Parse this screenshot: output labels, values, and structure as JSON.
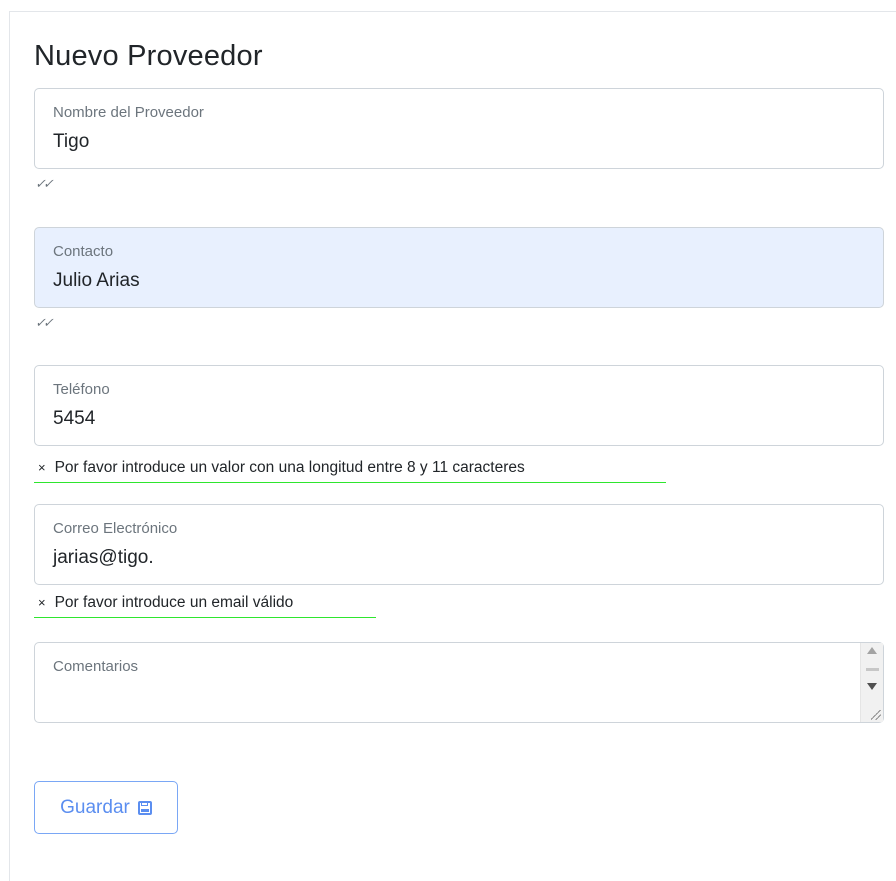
{
  "form": {
    "title": "Nuevo Proveedor",
    "fields": [
      {
        "label": "Nombre del Proveedor",
        "value": "Tigo",
        "status": "valid",
        "status_mark": "✓✓"
      },
      {
        "label": "Contacto",
        "value": "Julio Arias",
        "status": "valid",
        "status_mark": "✓✓"
      },
      {
        "label": "Teléfono",
        "value": "5454",
        "status": "invalid",
        "error_icon": "×",
        "error": "Por favor introduce un valor con una longitud entre 8 y 11 caracteres"
      },
      {
        "label": "Correo Electrónico",
        "value": "jarias@tigo.",
        "status": "invalid",
        "error_icon": "×",
        "error": "Por favor introduce un email válido"
      },
      {
        "label": "Comentarios",
        "value": ""
      }
    ],
    "save_label": "Guardar",
    "save_icon": "floppy-disk-icon"
  },
  "colors": {
    "autofill_bg": "#e8f0fe",
    "error_underline": "#2ee62e",
    "button_accent": "#5b8ef0"
  }
}
